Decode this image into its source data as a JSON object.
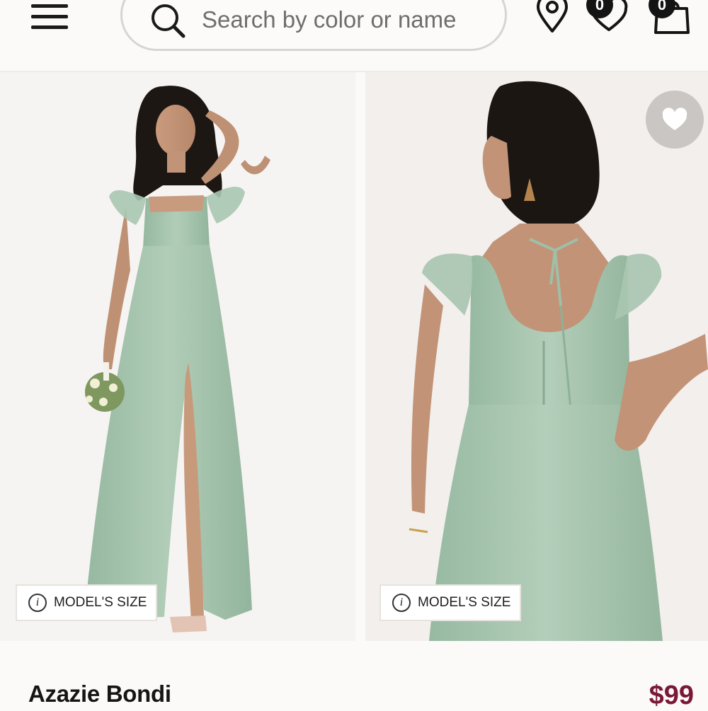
{
  "header": {
    "menu_icon": "hamburger-menu-icon",
    "search": {
      "placeholder": "Search by color or name",
      "icon": "search-icon"
    },
    "location_icon": "location-pin-icon",
    "wishlist": {
      "icon": "heart-icon",
      "count": "0"
    },
    "cart": {
      "icon": "shopping-bag-icon",
      "count": "0"
    }
  },
  "gallery": {
    "images": [
      {
        "alt": "Front view of sage green flutter sleeve chiffon dress with slit"
      },
      {
        "alt": "Back view of sage green dress with tie back detail"
      }
    ],
    "model_size_label": "MODEL'S SIZE",
    "info_icon": "i",
    "favorite_icon": "heart-icon"
  },
  "product": {
    "name": "Azazie Bondi",
    "price": "$99"
  },
  "colors": {
    "dress": "#a8c5b0",
    "price": "#7a1838",
    "badge": "#141414"
  }
}
